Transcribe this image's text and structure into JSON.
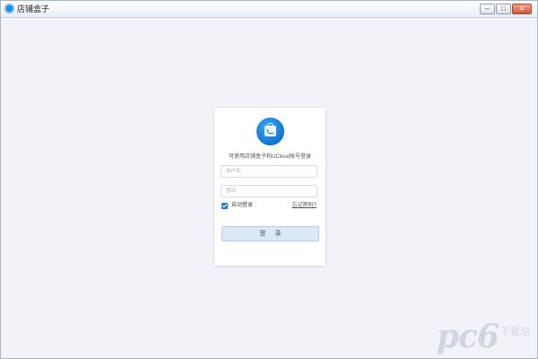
{
  "window": {
    "title": "店铺盒子",
    "controls": {
      "minimize": "–",
      "maximize": "□",
      "close": "×"
    }
  },
  "login": {
    "logo_icon": "shopping-bag-icon",
    "subtitle": "可使用店铺盒子和UCloud账号登录",
    "username_placeholder": "用户名",
    "password_placeholder": "密码",
    "auto_login_label": "自动登录",
    "auto_login_checked": true,
    "forgot_password": "忘记密码?",
    "login_button": "登 录"
  },
  "watermark": {
    "logo": "pc6",
    "text": "下载站"
  },
  "colors": {
    "accent": "#1e7ad9",
    "background": "#f1f3f8",
    "button_bg": "#dde8f5"
  }
}
